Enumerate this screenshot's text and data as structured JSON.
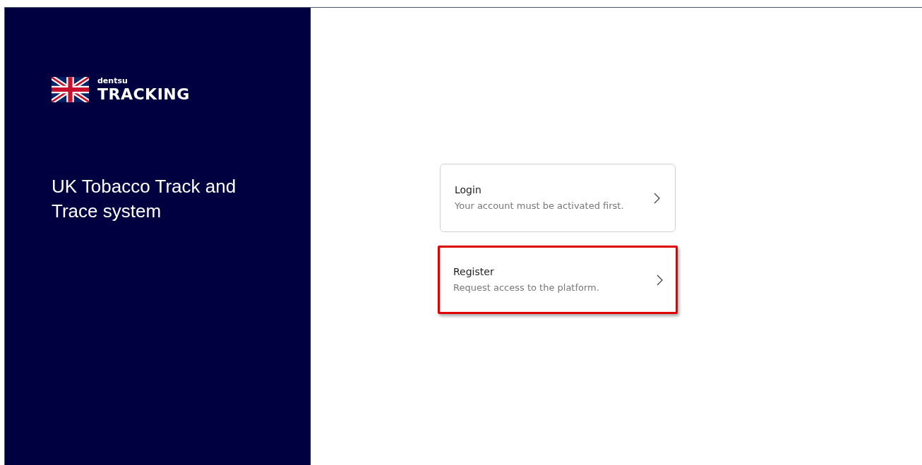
{
  "brand": {
    "company": "dentsu",
    "product": "TRACKING"
  },
  "headline": "UK Tobacco Track and Trace system",
  "options": [
    {
      "title": "Login",
      "description": "Your account must be activated first.",
      "highlighted": false
    },
    {
      "title": "Register",
      "description": "Request access to the platform.",
      "highlighted": true
    }
  ]
}
